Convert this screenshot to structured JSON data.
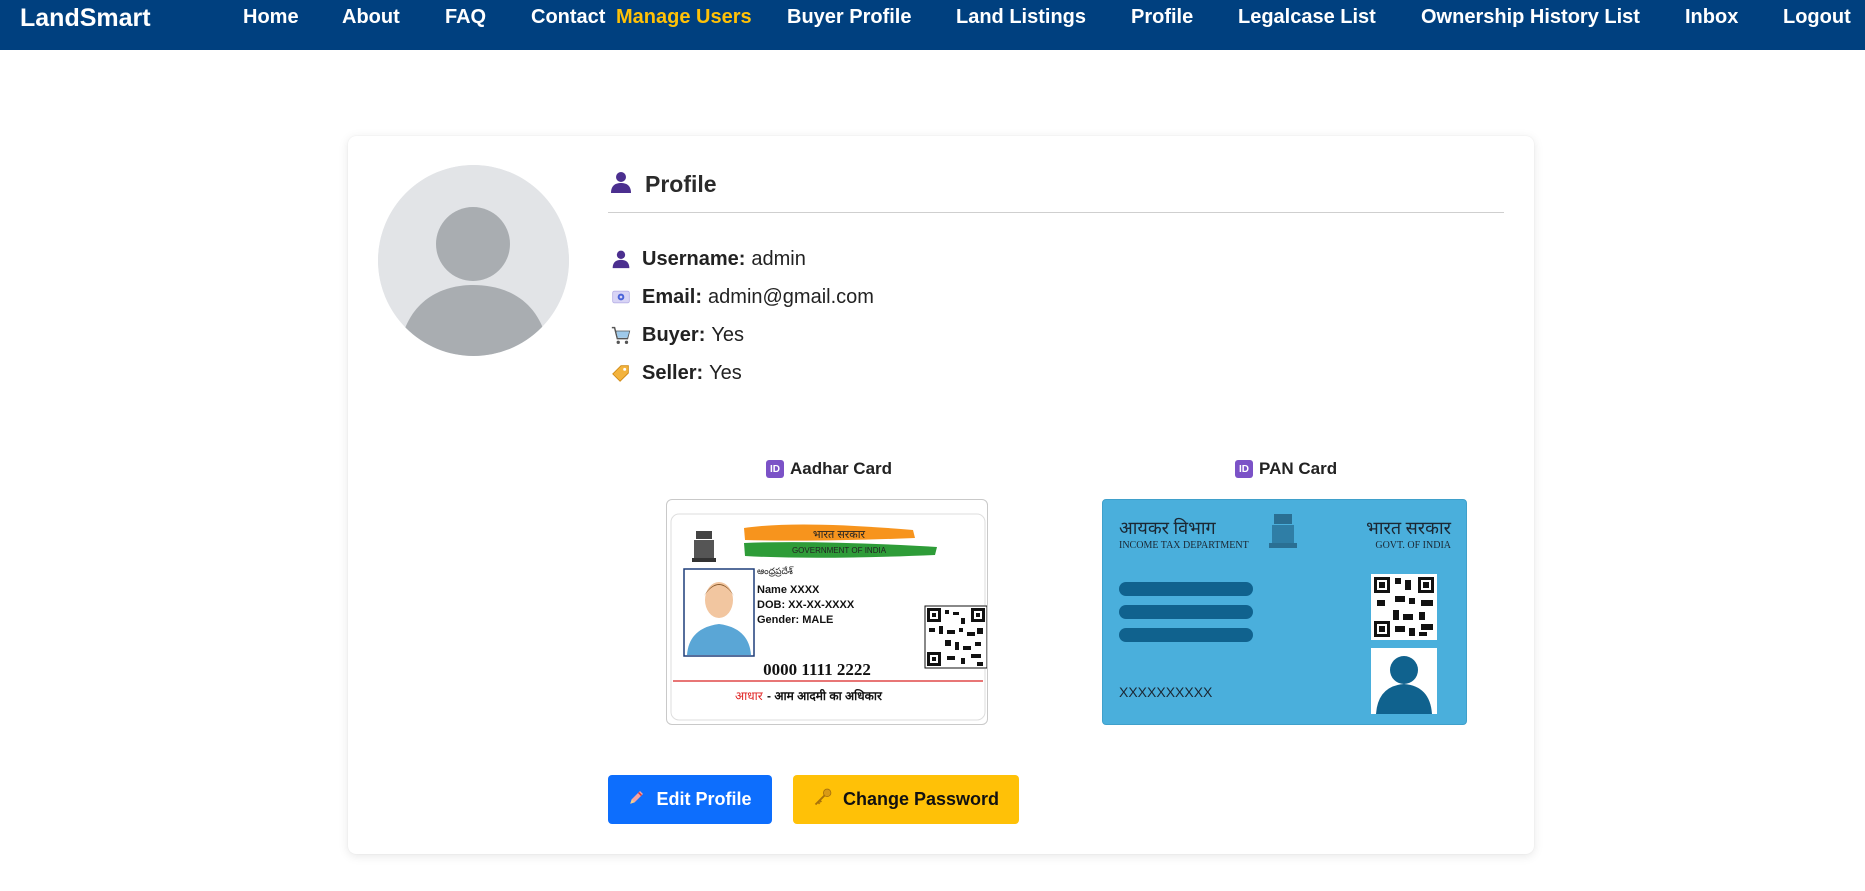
{
  "nav": {
    "brand": "LandSmart",
    "links": [
      "Home",
      "About",
      "FAQ",
      "Contact",
      "Manage Users",
      "Buyer Profile",
      "Land Listings",
      "Profile",
      "Legalcase List",
      "Ownership History List",
      "Inbox",
      "Logout"
    ],
    "active_index": 4
  },
  "profile": {
    "title": "Profile",
    "fields": [
      {
        "label": "Username:",
        "value": "admin",
        "icon": "user-icon"
      },
      {
        "label": "Email:",
        "value": "admin@gmail.com",
        "icon": "email-icon"
      },
      {
        "label": "Buyer:",
        "value": "Yes",
        "icon": "cart-icon"
      },
      {
        "label": "Seller:",
        "value": "Yes",
        "icon": "tag-icon"
      }
    ]
  },
  "documents": {
    "aadhar_label": "Aadhar Card",
    "pan_label": "PAN Card",
    "id_badge": "ID",
    "aadhar": {
      "header_hindi": "भारत सरकार",
      "header_english": "GOVERNMENT OF INDIA",
      "regional": "ఆంధ్రప్రదేశ్",
      "name": "Name XXXX",
      "dob": "DOB: XX-XX-XXXX",
      "gender": "Gender: MALE",
      "number": "0000 1111 2222",
      "footer_red": "आधार",
      "footer_black": " - आम आदमी का अधिकार"
    },
    "pan": {
      "dept_hindi": "आयकर विभाग",
      "dept_english": "INCOME TAX DEPARTMENT",
      "govt_hindi": "भारत सरकार",
      "govt_english": "GOVT. OF INDIA",
      "number": "XXXXXXXXXX"
    }
  },
  "actions": {
    "edit": "Edit Profile",
    "change_password": "Change Password"
  },
  "colors": {
    "navbar": "#00407f",
    "active_link": "#ffc107",
    "edit_button": "#0d6efd",
    "password_button": "#ffc107",
    "pan_card": "#4aafdc"
  }
}
